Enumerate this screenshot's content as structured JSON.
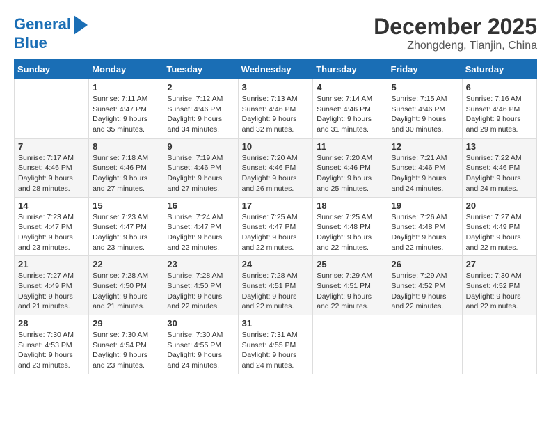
{
  "header": {
    "logo_line1": "General",
    "logo_line2": "Blue",
    "month_year": "December 2025",
    "location": "Zhongdeng, Tianjin, China"
  },
  "days_of_week": [
    "Sunday",
    "Monday",
    "Tuesday",
    "Wednesday",
    "Thursday",
    "Friday",
    "Saturday"
  ],
  "weeks": [
    [
      {
        "day": "",
        "info": ""
      },
      {
        "day": "1",
        "info": "Sunrise: 7:11 AM\nSunset: 4:47 PM\nDaylight: 9 hours\nand 35 minutes."
      },
      {
        "day": "2",
        "info": "Sunrise: 7:12 AM\nSunset: 4:46 PM\nDaylight: 9 hours\nand 34 minutes."
      },
      {
        "day": "3",
        "info": "Sunrise: 7:13 AM\nSunset: 4:46 PM\nDaylight: 9 hours\nand 32 minutes."
      },
      {
        "day": "4",
        "info": "Sunrise: 7:14 AM\nSunset: 4:46 PM\nDaylight: 9 hours\nand 31 minutes."
      },
      {
        "day": "5",
        "info": "Sunrise: 7:15 AM\nSunset: 4:46 PM\nDaylight: 9 hours\nand 30 minutes."
      },
      {
        "day": "6",
        "info": "Sunrise: 7:16 AM\nSunset: 4:46 PM\nDaylight: 9 hours\nand 29 minutes."
      }
    ],
    [
      {
        "day": "7",
        "info": "Sunrise: 7:17 AM\nSunset: 4:46 PM\nDaylight: 9 hours\nand 28 minutes."
      },
      {
        "day": "8",
        "info": "Sunrise: 7:18 AM\nSunset: 4:46 PM\nDaylight: 9 hours\nand 27 minutes."
      },
      {
        "day": "9",
        "info": "Sunrise: 7:19 AM\nSunset: 4:46 PM\nDaylight: 9 hours\nand 27 minutes."
      },
      {
        "day": "10",
        "info": "Sunrise: 7:20 AM\nSunset: 4:46 PM\nDaylight: 9 hours\nand 26 minutes."
      },
      {
        "day": "11",
        "info": "Sunrise: 7:20 AM\nSunset: 4:46 PM\nDaylight: 9 hours\nand 25 minutes."
      },
      {
        "day": "12",
        "info": "Sunrise: 7:21 AM\nSunset: 4:46 PM\nDaylight: 9 hours\nand 24 minutes."
      },
      {
        "day": "13",
        "info": "Sunrise: 7:22 AM\nSunset: 4:46 PM\nDaylight: 9 hours\nand 24 minutes."
      }
    ],
    [
      {
        "day": "14",
        "info": "Sunrise: 7:23 AM\nSunset: 4:47 PM\nDaylight: 9 hours\nand 23 minutes."
      },
      {
        "day": "15",
        "info": "Sunrise: 7:23 AM\nSunset: 4:47 PM\nDaylight: 9 hours\nand 23 minutes."
      },
      {
        "day": "16",
        "info": "Sunrise: 7:24 AM\nSunset: 4:47 PM\nDaylight: 9 hours\nand 22 minutes."
      },
      {
        "day": "17",
        "info": "Sunrise: 7:25 AM\nSunset: 4:47 PM\nDaylight: 9 hours\nand 22 minutes."
      },
      {
        "day": "18",
        "info": "Sunrise: 7:25 AM\nSunset: 4:48 PM\nDaylight: 9 hours\nand 22 minutes."
      },
      {
        "day": "19",
        "info": "Sunrise: 7:26 AM\nSunset: 4:48 PM\nDaylight: 9 hours\nand 22 minutes."
      },
      {
        "day": "20",
        "info": "Sunrise: 7:27 AM\nSunset: 4:49 PM\nDaylight: 9 hours\nand 22 minutes."
      }
    ],
    [
      {
        "day": "21",
        "info": "Sunrise: 7:27 AM\nSunset: 4:49 PM\nDaylight: 9 hours\nand 21 minutes."
      },
      {
        "day": "22",
        "info": "Sunrise: 7:28 AM\nSunset: 4:50 PM\nDaylight: 9 hours\nand 21 minutes."
      },
      {
        "day": "23",
        "info": "Sunrise: 7:28 AM\nSunset: 4:50 PM\nDaylight: 9 hours\nand 22 minutes."
      },
      {
        "day": "24",
        "info": "Sunrise: 7:28 AM\nSunset: 4:51 PM\nDaylight: 9 hours\nand 22 minutes."
      },
      {
        "day": "25",
        "info": "Sunrise: 7:29 AM\nSunset: 4:51 PM\nDaylight: 9 hours\nand 22 minutes."
      },
      {
        "day": "26",
        "info": "Sunrise: 7:29 AM\nSunset: 4:52 PM\nDaylight: 9 hours\nand 22 minutes."
      },
      {
        "day": "27",
        "info": "Sunrise: 7:30 AM\nSunset: 4:52 PM\nDaylight: 9 hours\nand 22 minutes."
      }
    ],
    [
      {
        "day": "28",
        "info": "Sunrise: 7:30 AM\nSunset: 4:53 PM\nDaylight: 9 hours\nand 23 minutes."
      },
      {
        "day": "29",
        "info": "Sunrise: 7:30 AM\nSunset: 4:54 PM\nDaylight: 9 hours\nand 23 minutes."
      },
      {
        "day": "30",
        "info": "Sunrise: 7:30 AM\nSunset: 4:55 PM\nDaylight: 9 hours\nand 24 minutes."
      },
      {
        "day": "31",
        "info": "Sunrise: 7:31 AM\nSunset: 4:55 PM\nDaylight: 9 hours\nand 24 minutes."
      },
      {
        "day": "",
        "info": ""
      },
      {
        "day": "",
        "info": ""
      },
      {
        "day": "",
        "info": ""
      }
    ]
  ]
}
